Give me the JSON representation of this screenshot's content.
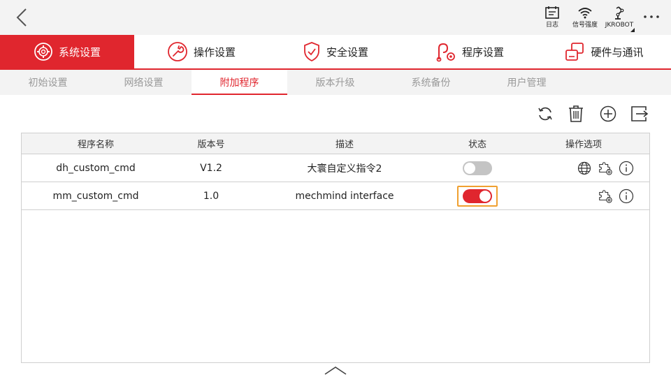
{
  "status_bar": {
    "log_label": "日志",
    "signal_label": "信号强度",
    "robot_label": "JKROBOT"
  },
  "main_tabs": [
    {
      "label": "系统设置",
      "icon": "gear-icon"
    },
    {
      "label": "操作设置",
      "icon": "wrench-icon"
    },
    {
      "label": "安全设置",
      "icon": "shield-check-icon"
    },
    {
      "label": "程序设置",
      "icon": "program-icon"
    },
    {
      "label": "硬件与通讯",
      "icon": "hardware-icon"
    }
  ],
  "active_main_tab": "系统设置",
  "sub_tabs": [
    "初始设置",
    "网络设置",
    "附加程序",
    "版本升级",
    "系统备份",
    "用户管理"
  ],
  "active_sub_tab": "附加程序",
  "table": {
    "headers": [
      "程序名称",
      "版本号",
      "描述",
      "状态",
      "操作选项"
    ],
    "rows": [
      {
        "name": "dh_custom_cmd",
        "version": "V1.2",
        "description": "大寰自定义指令2",
        "enabled": false,
        "actions": [
          "globe-icon",
          "plugin-settings-icon",
          "info-icon"
        ]
      },
      {
        "name": "mm_custom_cmd",
        "version": "1.0",
        "description": "mechmind interface",
        "enabled": true,
        "actions": [
          "plugin-settings-icon",
          "info-icon"
        ]
      }
    ]
  },
  "colors": {
    "accent": "#e0262e",
    "toggle_off": "#c4c4c4",
    "focus_outline": "#f0a030",
    "header_bg": "#f3f3f3"
  }
}
